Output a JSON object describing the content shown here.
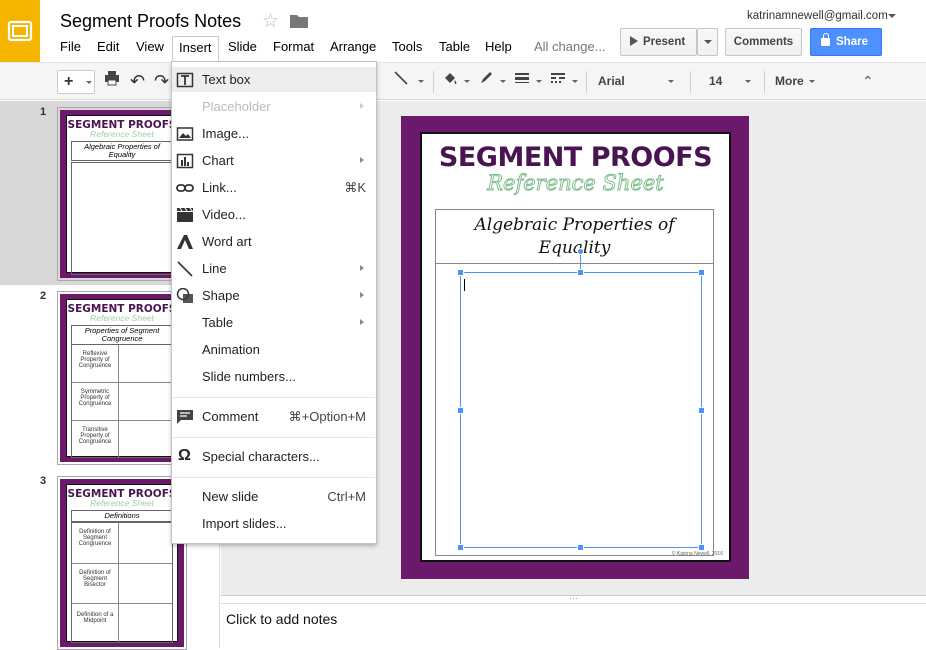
{
  "app": {
    "title": "Segment Proofs Notes",
    "account": "katrinamnewell@gmail.com",
    "save_status": "All change..."
  },
  "menubar": [
    "File",
    "Edit",
    "View",
    "Insert",
    "Slide",
    "Format",
    "Arrange",
    "Tools",
    "Table",
    "Help"
  ],
  "buttons": {
    "present": "Present",
    "comments": "Comments",
    "share": "Share"
  },
  "toolbar": {
    "font": "Arial",
    "size": "14",
    "more": "More"
  },
  "insert_menu": [
    {
      "label": "Text box",
      "icon": "text-box-icon",
      "highlighted": true
    },
    {
      "label": "Placeholder",
      "disabled": true,
      "submenu": true
    },
    {
      "label": "Image...",
      "icon": "image-icon"
    },
    {
      "label": "Chart",
      "icon": "chart-icon",
      "submenu": true
    },
    {
      "label": "Link...",
      "icon": "link-icon",
      "shortcut": "⌘K"
    },
    {
      "label": "Video...",
      "icon": "video-icon"
    },
    {
      "label": "Word art",
      "icon": "word-art-icon"
    },
    {
      "label": "Line",
      "icon": "line-icon",
      "submenu": true
    },
    {
      "label": "Shape",
      "icon": "shape-icon",
      "submenu": true
    },
    {
      "label": "Table",
      "submenu": true
    },
    {
      "label": "Animation"
    },
    {
      "label": "Slide numbers..."
    },
    {
      "label": "Comment",
      "icon": "comment-icon",
      "shortcut": "⌘+Option+M"
    },
    {
      "label": "Special characters...",
      "icon": "omega-icon"
    },
    {
      "label": "New slide",
      "shortcut": "Ctrl+M"
    },
    {
      "label": "Import slides..."
    }
  ],
  "slides": [
    {
      "number": "1",
      "title": "SEGMENT PROOFS",
      "subtitle": "Reference Sheet",
      "header": "Algebraic Properties of Equality",
      "rows": []
    },
    {
      "number": "2",
      "title": "SEGMENT PROOFS",
      "subtitle": "Reference Sheet",
      "header": "Properties of Segment Congruence",
      "rows": [
        "Reflexive Property of Congruence",
        "Symmetric Property of Congruence",
        "Transitive Property of Congruence"
      ]
    },
    {
      "number": "3",
      "title": "SEGMENT PROOFS",
      "subtitle": "Reference Sheet",
      "header": "Definitions",
      "rows": [
        "Definition of Segment Congruence",
        "Definition of Segment Bisector",
        "Definition of a Midpoint"
      ]
    }
  ],
  "current_slide": {
    "title": "SEGMENT PROOFS",
    "subtitle": "Reference Sheet",
    "header": "Algebraic Properties of Equality",
    "copyright": "© Katrina Newell, 2016"
  },
  "notes": {
    "placeholder": "Click to add notes"
  },
  "colors": {
    "logo": "#f4b400",
    "share": "#4d90fe",
    "slide_border": "#6b1a6b",
    "title": "#4a1452",
    "subtitle": "#7fbf8a"
  }
}
